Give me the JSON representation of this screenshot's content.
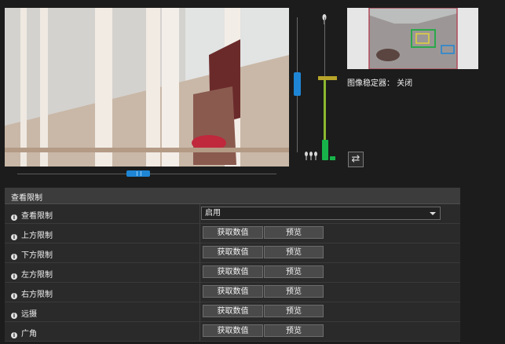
{
  "image_stabilizer": {
    "label": "图像稳定器：",
    "value": "关闭"
  },
  "controls": {
    "swap_icon": "swap-arrows-icon",
    "tele_icon": "tele-icon",
    "wide_icon": "wide-icon"
  },
  "panel": {
    "header": "查看限制",
    "rows": [
      {
        "label": "查看限制",
        "type": "select",
        "value": "启用"
      },
      {
        "label": "上方限制",
        "type": "buttons",
        "get": "获取数值",
        "preview": "预览"
      },
      {
        "label": "下方限制",
        "type": "buttons",
        "get": "获取数值",
        "preview": "预览"
      },
      {
        "label": "左方限制",
        "type": "buttons",
        "get": "获取数值",
        "preview": "预览"
      },
      {
        "label": "右方限制",
        "type": "buttons",
        "get": "获取数值",
        "preview": "预览"
      },
      {
        "label": "远摄",
        "type": "buttons",
        "get": "获取数值",
        "preview": "预览"
      },
      {
        "label": "广角",
        "type": "buttons",
        "get": "获取数值",
        "preview": "预览"
      }
    ]
  },
  "colors": {
    "accent": "#1f86d6",
    "zoom": "#17b34a",
    "thumb_frame": "#b14a5a"
  }
}
